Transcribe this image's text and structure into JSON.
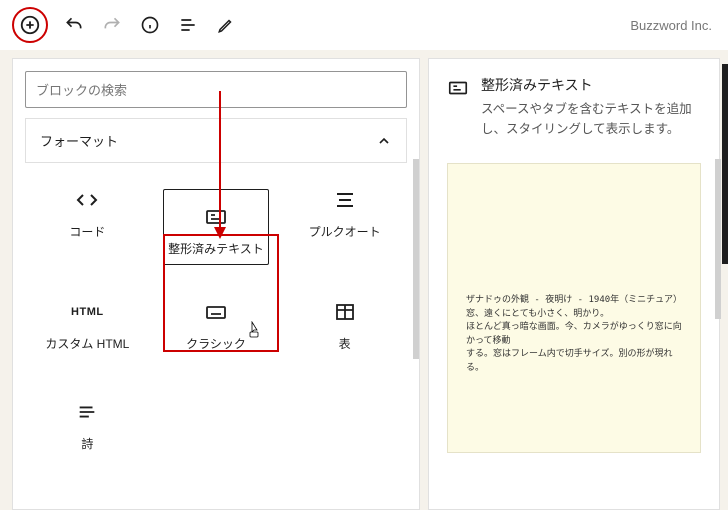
{
  "brand": "Buzzword Inc.",
  "search": {
    "placeholder": "ブロックの検索"
  },
  "category": {
    "label": "フォーマット"
  },
  "blocks": {
    "code": "コード",
    "preformatted": "整形済みテキスト",
    "pullquote": "プルクオート",
    "customHtmlIcon": "HTML",
    "customHtml": "カスタム HTML",
    "classic": "クラシック",
    "table": "表",
    "verse": "詩"
  },
  "rightPanel": {
    "title": "整形済みテキスト",
    "desc": "スペースやタブを含むテキストを追加し、スタイリングして表示します。"
  },
  "preview": {
    "line1": "ザナドゥの外観 - 夜明け - 1940年（ミニチュア）",
    "line2": "窓、遠くにとても小さく、明かり。",
    "line3": "ほとんど真っ暗な画面。今、カメラがゆっくり窓に向かって移動",
    "line4": "する。窓はフレーム内で切手サイズ。別の形が現れる。"
  }
}
